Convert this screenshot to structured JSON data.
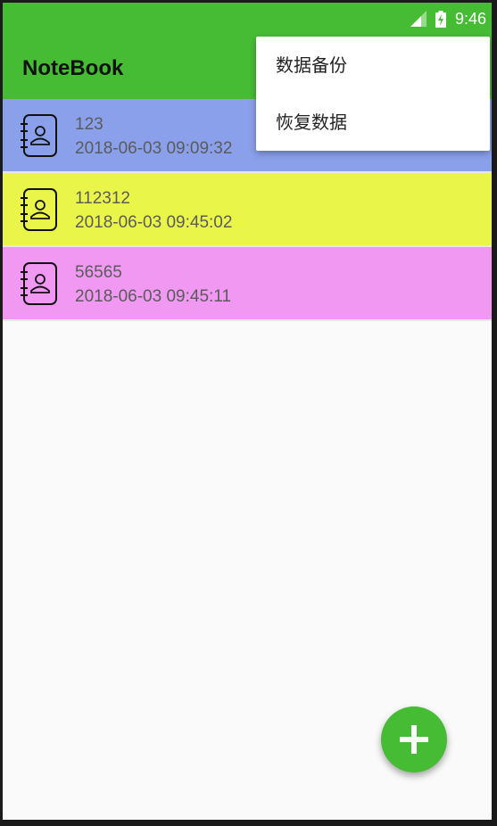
{
  "status_bar": {
    "time": "9:46",
    "icons": [
      "signal-icon",
      "battery-charging-icon"
    ]
  },
  "app_bar": {
    "title": "NoteBook",
    "color": "#46bc34"
  },
  "overflow_menu": {
    "items": [
      {
        "label": "数据备份"
      },
      {
        "label": "恢复数据"
      }
    ]
  },
  "notes": [
    {
      "title": "123",
      "time": "2018-06-03 09:09:32",
      "color": "#8aa0ea",
      "icon": "notebook-contact-icon"
    },
    {
      "title": "112312",
      "time": "2018-06-03 09:45:02",
      "color": "#eaf54a",
      "icon": "notebook-contact-icon"
    },
    {
      "title": "56565",
      "time": "2018-06-03 09:45:11",
      "color": "#f198f3",
      "icon": "notebook-contact-icon"
    }
  ],
  "fab": {
    "icon": "plus-icon",
    "color": "#46bc34"
  }
}
